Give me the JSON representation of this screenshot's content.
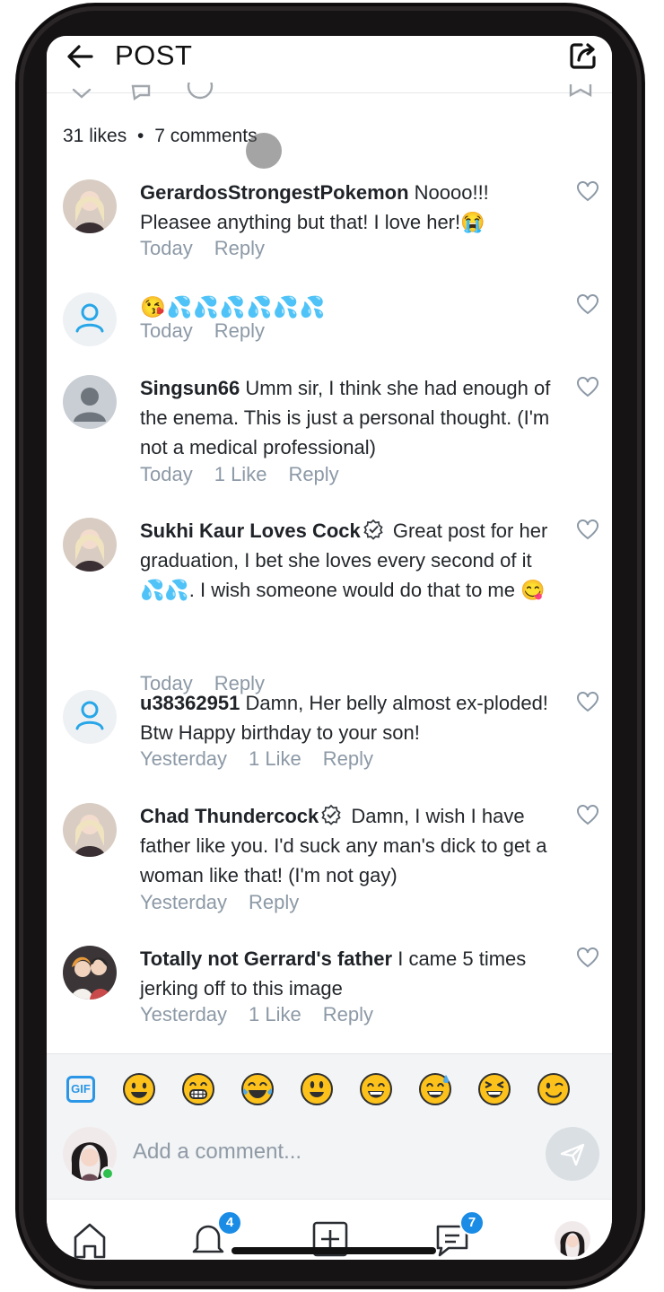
{
  "header": {
    "title": "POST"
  },
  "stats": {
    "likes": "31 likes",
    "separator": "•",
    "comments": "7 comments"
  },
  "comments": [
    {
      "username": "GerardosStrongestPokemon",
      "text": " Noooo!!! Pleasee anything but that! I love her!",
      "emoji_after": "😭",
      "time": "Today",
      "likes": "",
      "reply": "Reply"
    },
    {
      "username": "",
      "text": "",
      "emoji_text": "😘💦💦💦💦💦💦",
      "time": "Today",
      "likes": "",
      "reply": "Reply"
    },
    {
      "username": "Singsun66",
      "text": " Umm sir, I think she had enough of the enema. This is just a personal thought. (I'm not a medical professional)",
      "time": "Today",
      "likes": "1 Like",
      "reply": "Reply"
    },
    {
      "username": "Sukhi Kaur Loves Cock",
      "verified": true,
      "text": " Great post for her graduation, I bet she loves every second of it ",
      "emoji_mid": "💦💦",
      "text2": ". I wish someone would do that to me ",
      "emoji_after": "😋",
      "time": "Today",
      "likes": "",
      "reply": "Reply"
    },
    {
      "username": "u38362951",
      "text": " Damn, Her belly almost ex-ploded! Btw Happy birthday to your son!",
      "time": "Yesterday",
      "likes": "1 Like",
      "reply": "Reply"
    },
    {
      "username": "Chad Thundercock",
      "verified": true,
      "text": " Damn, I wish I have father like you. I'd suck any man's dick to get a woman like that! (I'm not gay)",
      "time": "Yesterday",
      "likes": "",
      "reply": "Reply"
    },
    {
      "username": "Totally not Gerrard's father",
      "text": " I came 5 times jerking off to this image",
      "time": "Yesterday",
      "likes": "1 Like",
      "reply": "Reply"
    }
  ],
  "emoji_bar": {
    "gif_label": "GIF",
    "emojis": [
      "grinning",
      "grin",
      "joy",
      "smiley",
      "smile",
      "sweat-smile",
      "laughing",
      "wink"
    ]
  },
  "composer": {
    "placeholder": "Add a comment..."
  },
  "nav": {
    "notifications_badge": "4",
    "messages_badge": "7"
  },
  "colors": {
    "accent": "#1a8ce6",
    "meta": "#8c99a6",
    "online": "#2fbf4d",
    "emoji_yellow": "#fcc21b"
  }
}
